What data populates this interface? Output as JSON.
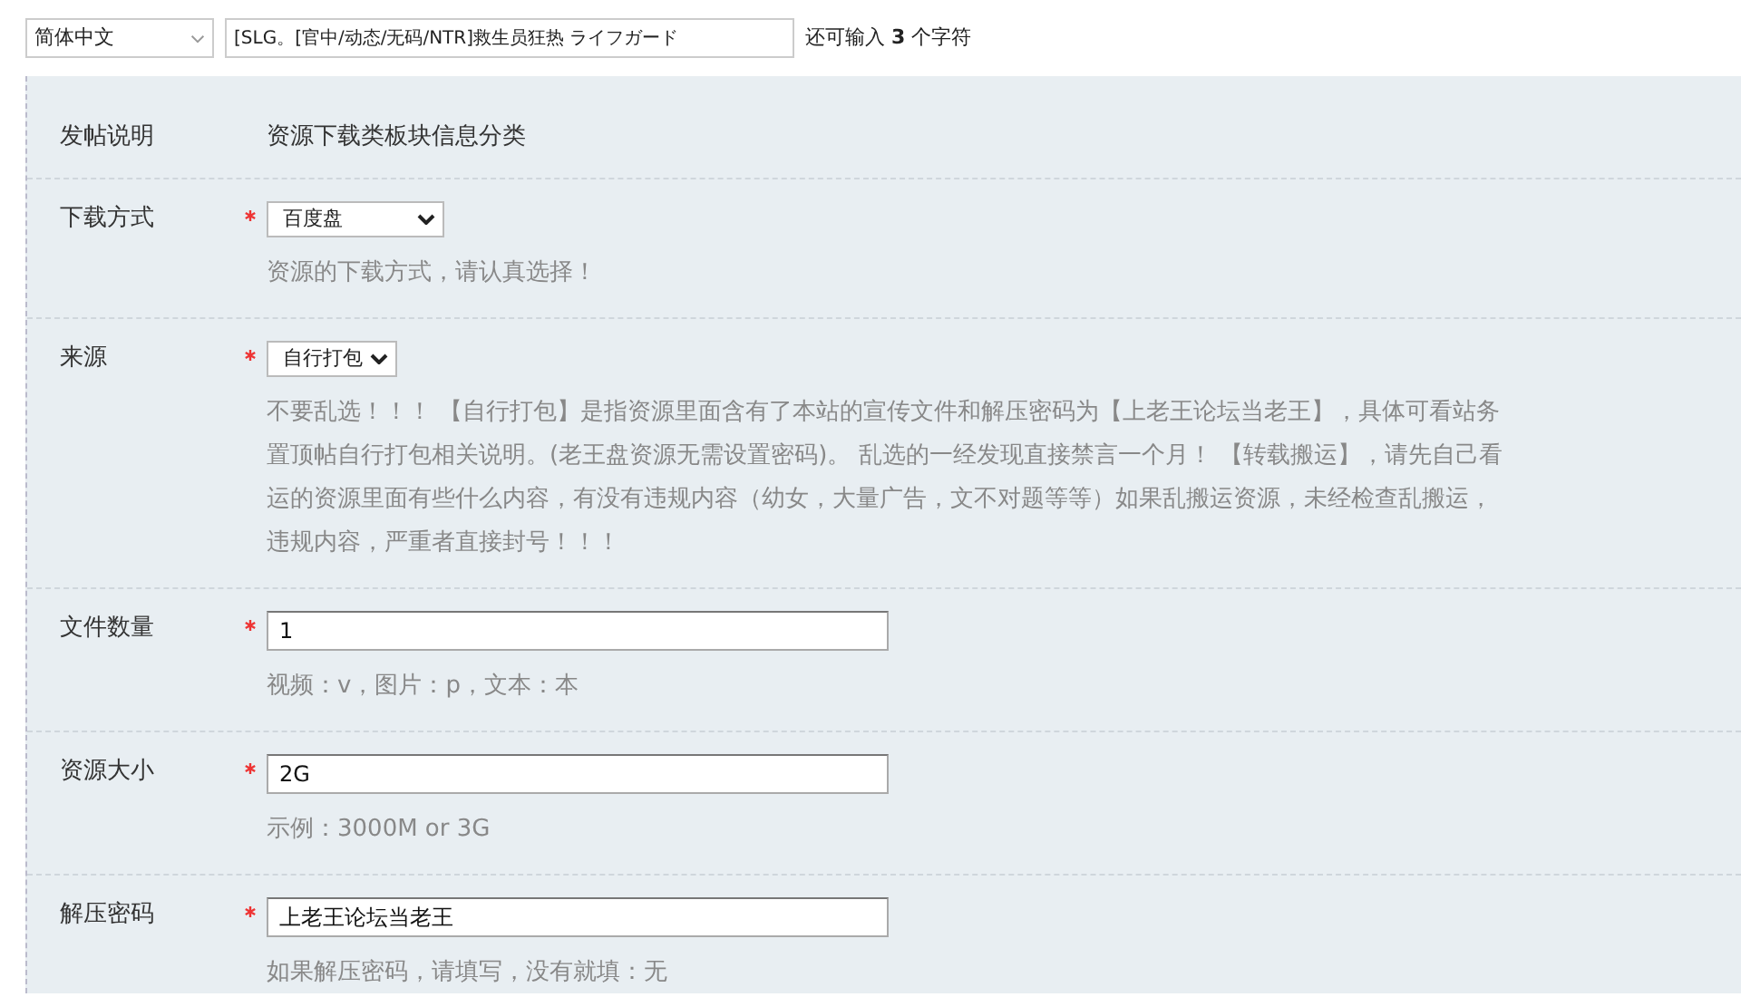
{
  "header": {
    "language_select": "简体中文",
    "title_input": "[SLG。[官中/动态/无码/NTR]救生员狂热 ライフガード",
    "char_count": "还可输入 **3** 个字符"
  },
  "fields": [
    {
      "kind": "static",
      "label": "发帖说明",
      "value": "资源下载类板块信息分类"
    },
    {
      "kind": "select",
      "label": "下载方式",
      "required": true,
      "value": "百度盘",
      "hint_lines": [
        "资源的下载方式，请认真选择！"
      ]
    },
    {
      "kind": "select",
      "label": "来源",
      "required": true,
      "value": "自行打包",
      "hint_lines": [
        "不要乱选！！！ 【自行打包】是指资源里面含有了本站的宣传文件和解压密码为【上老王论坛当老王】，具体可看站务",
        "置顶帖自行打包相关说明。(老王盘资源无需设置密码)。 乱选的一经发现直接禁言一个月！ 【转载搬运】，请先自己看",
        "运的资源里面有些什么内容，有没有违规内容（幼女，大量广告，文不对题等等）如果乱搬运资源，未经检查乱搬运，",
        "违规内容，严重者直接封号！！！"
      ]
    },
    {
      "kind": "input",
      "label": "文件数量",
      "required": true,
      "value": "1",
      "hint_lines": [
        "视频：v，图片：p，文本：本"
      ]
    },
    {
      "kind": "input",
      "label": "资源大小",
      "required": true,
      "value": "2G",
      "hint_lines": [
        "示例：3000M or 3G"
      ]
    },
    {
      "kind": "input",
      "label": "解压密码",
      "required": true,
      "value": "上老王论坛当老王",
      "hint_lines": [
        "如果解压密码，请填写，没有就填：无"
      ]
    }
  ]
}
